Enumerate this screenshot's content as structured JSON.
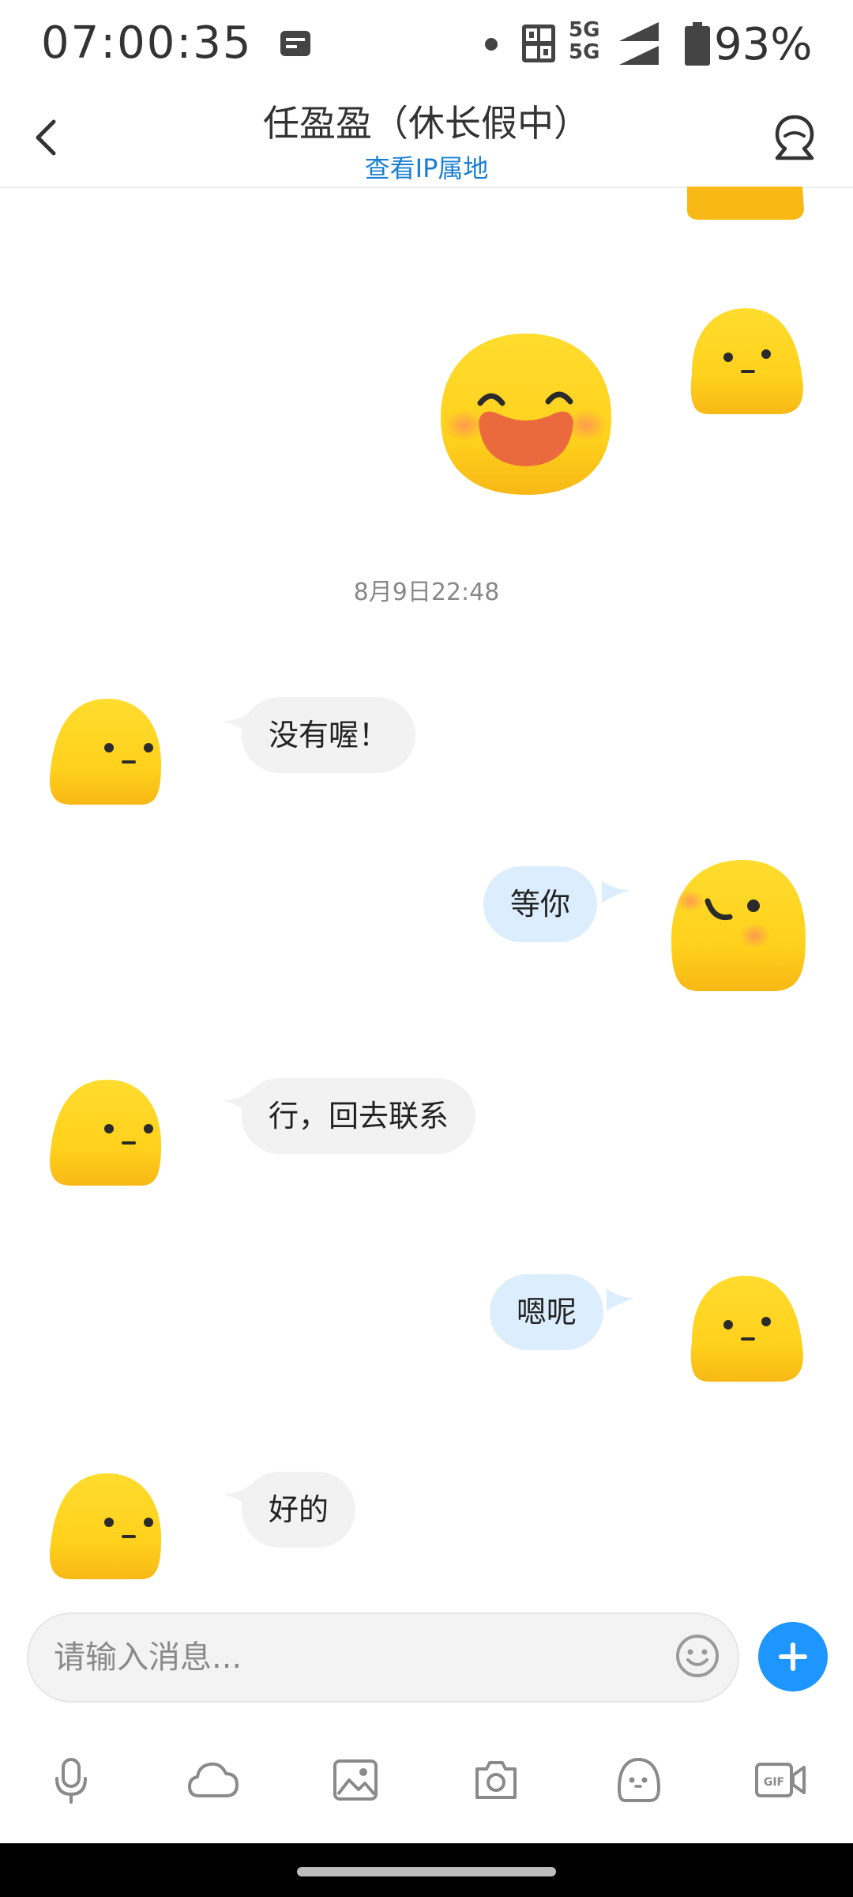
{
  "status_bar": {
    "time": "07:00:35",
    "network_top": "5G",
    "network_bottom": "5G",
    "battery": "93%"
  },
  "header": {
    "title": "任盈盈（休长假中）",
    "subtitle": "查看IP属地"
  },
  "chat": {
    "timestamp": "8月9日22:48",
    "messages": [
      {
        "side": "in",
        "text": "没有喔！"
      },
      {
        "side": "out",
        "text": "等你"
      },
      {
        "side": "in",
        "text": "行，回去联系"
      },
      {
        "side": "out",
        "text": "嗯呢"
      },
      {
        "side": "in",
        "text": "好的"
      }
    ]
  },
  "input": {
    "placeholder": "请输入消息..."
  },
  "toolbar": {
    "icons": [
      "microphone-icon",
      "cloud-icon",
      "image-icon",
      "camera-icon",
      "sticker-icon",
      "gif-icon"
    ]
  },
  "colors": {
    "accent": "#1e96ff",
    "link": "#1a7fd3",
    "bubble_in": "#f2f2f2",
    "bubble_out": "#dceefd",
    "avatar_yellow": "#ffd21f"
  }
}
